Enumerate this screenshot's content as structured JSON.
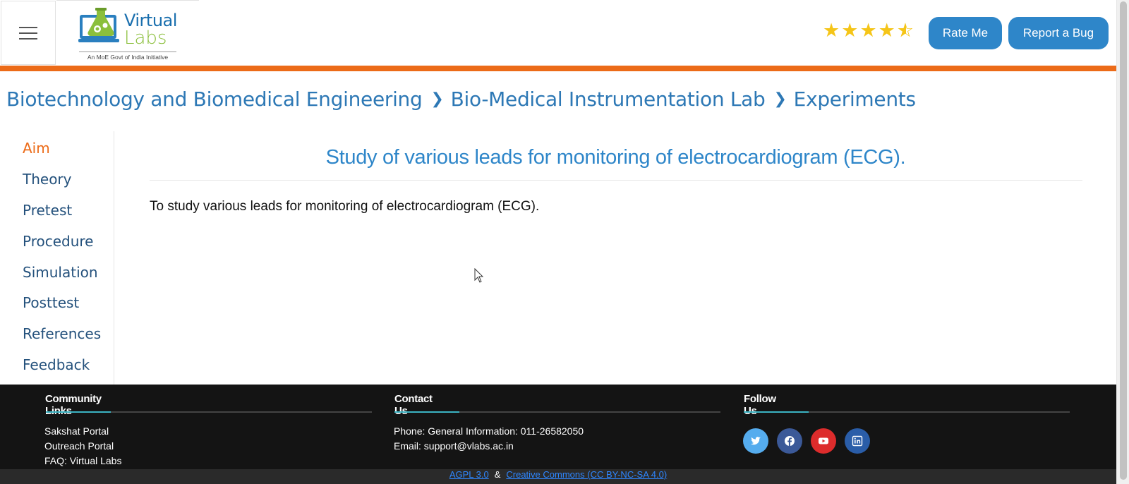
{
  "header": {
    "logo": {
      "line1": "Virtual",
      "line2": "Labs",
      "tagline": "An MoE Govt of India Initiative"
    },
    "rating": {
      "value": 4.5,
      "max": 5,
      "color": "#f5c518"
    },
    "rate_label": "Rate Me",
    "bug_label": "Report a Bug",
    "accent_color": "#ec6b18",
    "button_color": "#2e86c9"
  },
  "breadcrumb": [
    "Biotechnology and Biomedical Engineering",
    "Bio-Medical Instrumentation Lab",
    "Experiments"
  ],
  "sidebar": {
    "items": [
      {
        "label": "Aim",
        "active": true
      },
      {
        "label": "Theory",
        "active": false
      },
      {
        "label": "Pretest",
        "active": false
      },
      {
        "label": "Procedure",
        "active": false
      },
      {
        "label": "Simulation",
        "active": false
      },
      {
        "label": "Posttest",
        "active": false
      },
      {
        "label": "References",
        "active": false
      },
      {
        "label": "Feedback",
        "active": false
      }
    ]
  },
  "main": {
    "title": "Study of various leads for monitoring of electrocardiogram (ECG).",
    "aim_text": "To study various leads for monitoring of electrocardiogram (ECG)."
  },
  "footer": {
    "community": {
      "heading": "Community Links",
      "links": [
        "Sakshat Portal",
        "Outreach Portal",
        "FAQ: Virtual Labs"
      ]
    },
    "contact": {
      "heading": "Contact Us",
      "phone": "Phone: General Information: 011-26582050",
      "email": "Email: support@vlabs.ac.in"
    },
    "follow": {
      "heading": "Follow Us",
      "icons": [
        "twitter-icon",
        "facebook-icon",
        "youtube-icon",
        "linkedin-icon"
      ]
    },
    "license": {
      "left": "AGPL 3.0",
      "amp": "&",
      "right": "Creative Commons (CC BY-NC-SA 4.0)"
    }
  }
}
